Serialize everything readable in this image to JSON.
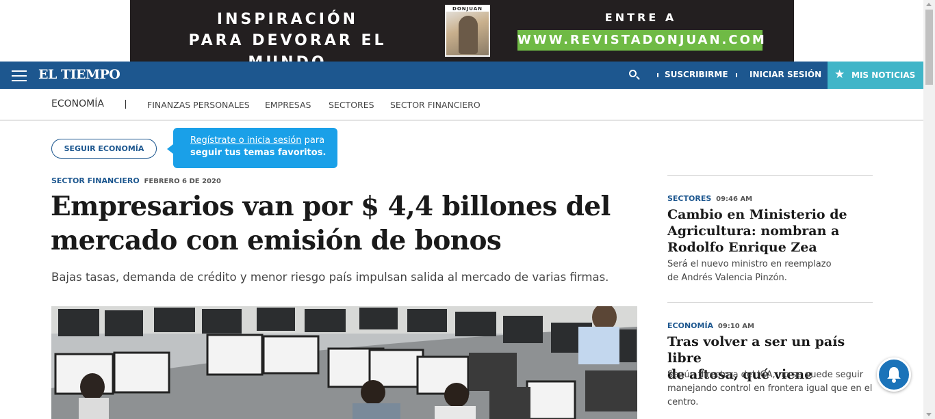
{
  "ad": {
    "line1": "INSPIRACIÓN",
    "line2": "PARA DEVORAR EL MUNDO",
    "cover_title": "DONJUAN",
    "entre": "ENTRE A",
    "url": "WWW.REVISTADONJUAN.COM"
  },
  "header": {
    "logo": "EL TIEMPO",
    "subscribe": "SUSCRIBIRME",
    "login": "INICIAR SESIÓN",
    "my_news": "MIS NOTICIAS",
    "brand_color": "#1d578f",
    "accent_color": "#40b5c8"
  },
  "section_nav": {
    "current": "ECONOMÍA",
    "items": [
      "FINANZAS PERSONALES",
      "EMPRESAS",
      "SECTORES",
      "SECTOR FINANCIERO"
    ]
  },
  "follow": {
    "button": "SEGUIR ECONOMÍA",
    "tooltip_link": "Regístrate o inicia sesión",
    "tooltip_rest1": " para",
    "tooltip_rest2": "seguir tus temas favoritos."
  },
  "article": {
    "category": "SECTOR FINANCIERO",
    "date": "FEBRERO 6 DE 2020",
    "headline_line1": "Empresarios van por $ 4,4 billones del",
    "headline_line2": "mercado con emisión de bonos",
    "subhead": "Bajas tasas, demanda de crédito y menor riesgo país impulsan salida al mercado de varias firmas."
  },
  "sidebar": {
    "items": [
      {
        "category": "SECTORES",
        "time": "09:46 AM",
        "title_lines": [
          "Cambio en Ministerio de",
          "Agricultura: nombran a",
          "Rodolfo Enrique Zea"
        ],
        "desc_lines": [
          "Será el nuevo ministro en reemplazo",
          "de Andrés Valencia Pinzón."
        ]
      },
      {
        "category": "ECONOMÍA",
        "time": "09:10 AM",
        "title_lines": [
          "Tras volver a ser un país libre",
          "de aftosa, qué viene"
        ],
        "desc_lines": [
          "Según directora del ICA, no se puede seguir",
          "manejando control en frontera igual que en el",
          "centro."
        ]
      }
    ]
  }
}
